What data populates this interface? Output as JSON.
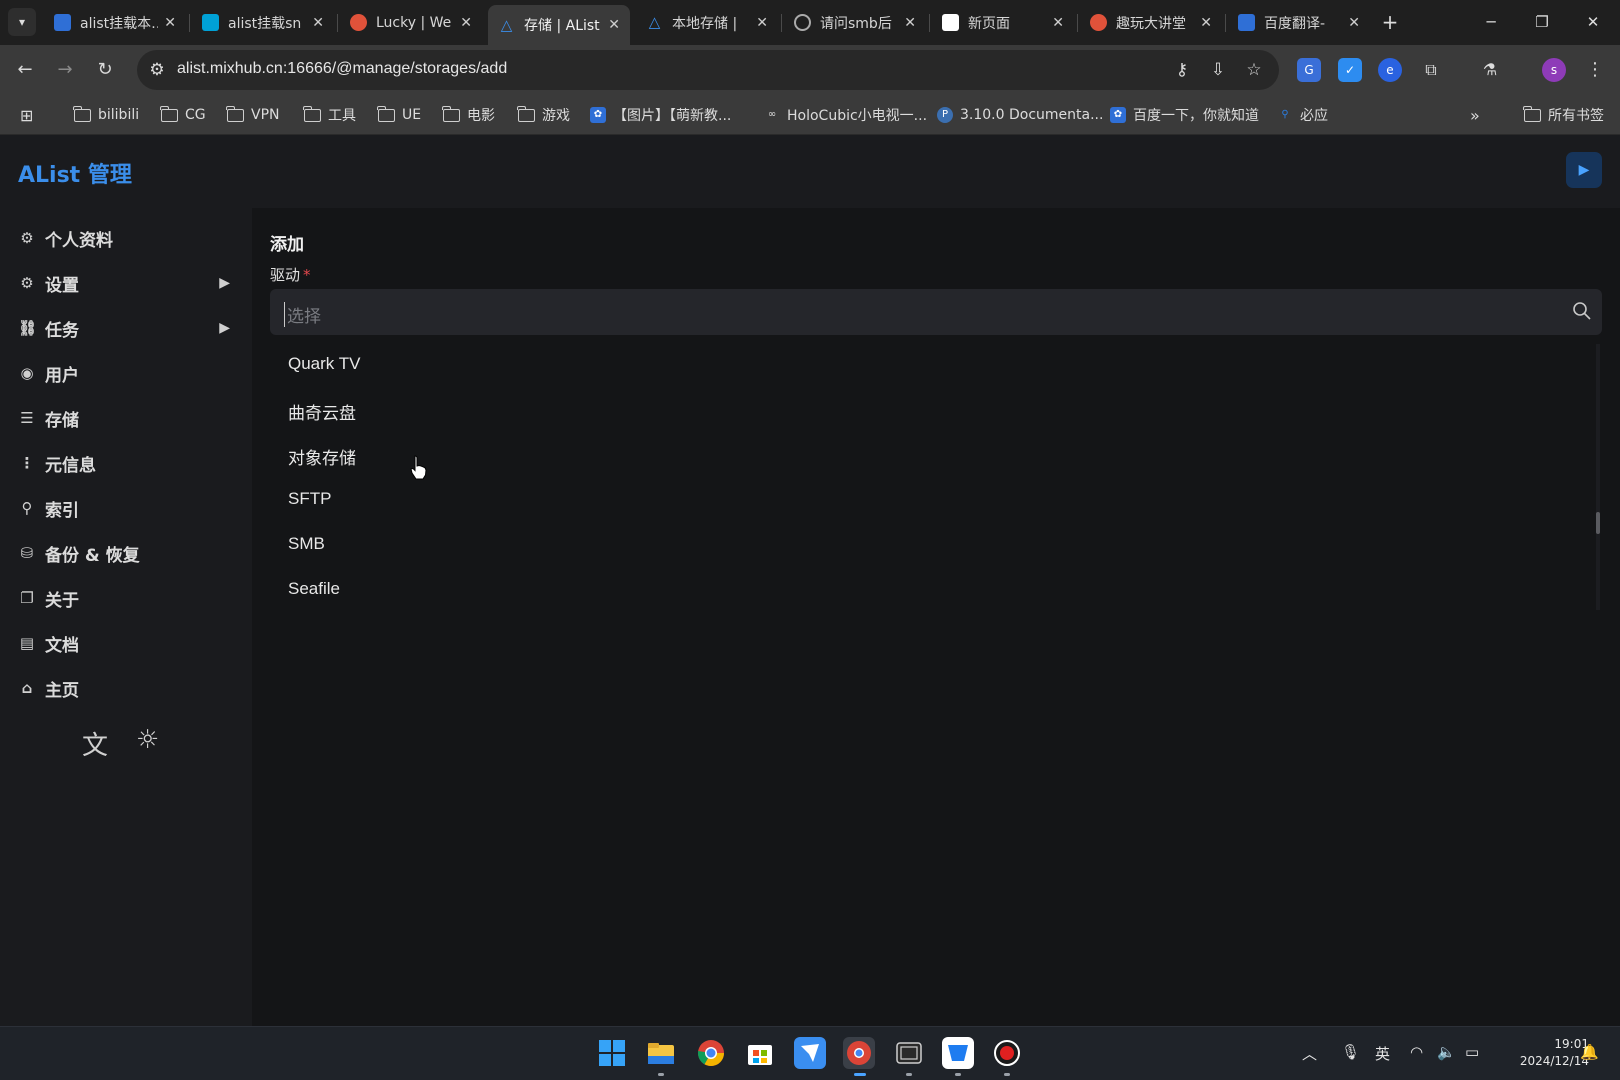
{
  "browser": {
    "tabs": [
      {
        "title": "alist挂载本…",
        "favicon_color": "#2f6fd6"
      },
      {
        "title": "alist挂载sn",
        "favicon_color": "#00a1d6"
      },
      {
        "title": "Lucky | We",
        "favicon_color": "#e0523a"
      },
      {
        "title": "存储 | AList",
        "favicon_color": "#3b8eea",
        "active": true
      },
      {
        "title": "本地存储 |",
        "favicon_color": "#3b8eea"
      },
      {
        "title": "请问smb后",
        "favicon_color": "#9a9a9a"
      },
      {
        "title": "新页面",
        "favicon_color": "#ffffff"
      },
      {
        "title": "趣玩大讲堂",
        "favicon_color": "#e0523a"
      },
      {
        "title": "百度翻译-",
        "favicon_color": "#2f6fd6"
      }
    ],
    "new_tab": "+",
    "url": "alist.mixhub.cn:16666/@manage/storages/add",
    "bookmarks": [
      {
        "label": "bilibili",
        "type": "folder"
      },
      {
        "label": "CG",
        "type": "folder"
      },
      {
        "label": "VPN",
        "type": "folder"
      },
      {
        "label": "工具",
        "type": "folder"
      },
      {
        "label": "UE",
        "type": "folder"
      },
      {
        "label": "电影",
        "type": "folder"
      },
      {
        "label": "游戏",
        "type": "folder"
      },
      {
        "label": "【图片】【萌新教...",
        "type": "link",
        "color": "#2f6fd6"
      },
      {
        "label": "HoloCubic小电视一...",
        "type": "link",
        "color": "#444444"
      },
      {
        "label": "3.10.0 Documenta...",
        "type": "link",
        "color": "#f2c744"
      },
      {
        "label": "百度一下，你就知道",
        "type": "link",
        "color": "#2f6fd6"
      },
      {
        "label": "必应",
        "type": "link",
        "color": "#2a7de1"
      }
    ],
    "bookmarks_more": "»",
    "all_bookmarks": "所有书签"
  },
  "app": {
    "brand": "AList 管理",
    "sidebar": [
      {
        "label": "个人资料",
        "icon": "user-profile-icon",
        "glyph": "⚙",
        "arrow": false
      },
      {
        "label": "设置",
        "icon": "gear-icon",
        "glyph": "⚙",
        "arrow": true
      },
      {
        "label": "任务",
        "icon": "tasks-icon",
        "glyph": "⛓",
        "arrow": true
      },
      {
        "label": "用户",
        "icon": "user-circle-icon",
        "glyph": "◉",
        "arrow": false
      },
      {
        "label": "存储",
        "icon": "storage-icon",
        "glyph": "☰",
        "arrow": false
      },
      {
        "label": "元信息",
        "icon": "metadata-icon",
        "glyph": "⋮",
        "arrow": false
      },
      {
        "label": "索引",
        "icon": "search-icon",
        "glyph": "⚲",
        "arrow": false
      },
      {
        "label": "备份 & 恢复",
        "icon": "database-icon",
        "glyph": "⛁",
        "arrow": false
      },
      {
        "label": "关于",
        "icon": "copy-icon",
        "glyph": "❐",
        "arrow": false
      },
      {
        "label": "文档",
        "icon": "book-icon",
        "glyph": "▤",
        "arrow": false
      },
      {
        "label": "主页",
        "icon": "home-icon",
        "glyph": "⌂",
        "arrow": false
      }
    ],
    "main": {
      "title": "添加",
      "driver_label": "驱动",
      "required_mark": "*",
      "select_placeholder": "选择",
      "options": [
        "Quark TV",
        "曲奇云盘",
        "对象存储",
        "SFTP",
        "SMB",
        "Seafile"
      ]
    }
  },
  "taskbar": {
    "tray_lang": "英",
    "time": "19:01",
    "date": "2024/12/14"
  },
  "colors": {
    "accent": "#3b8eea",
    "required": "#e5484d"
  }
}
